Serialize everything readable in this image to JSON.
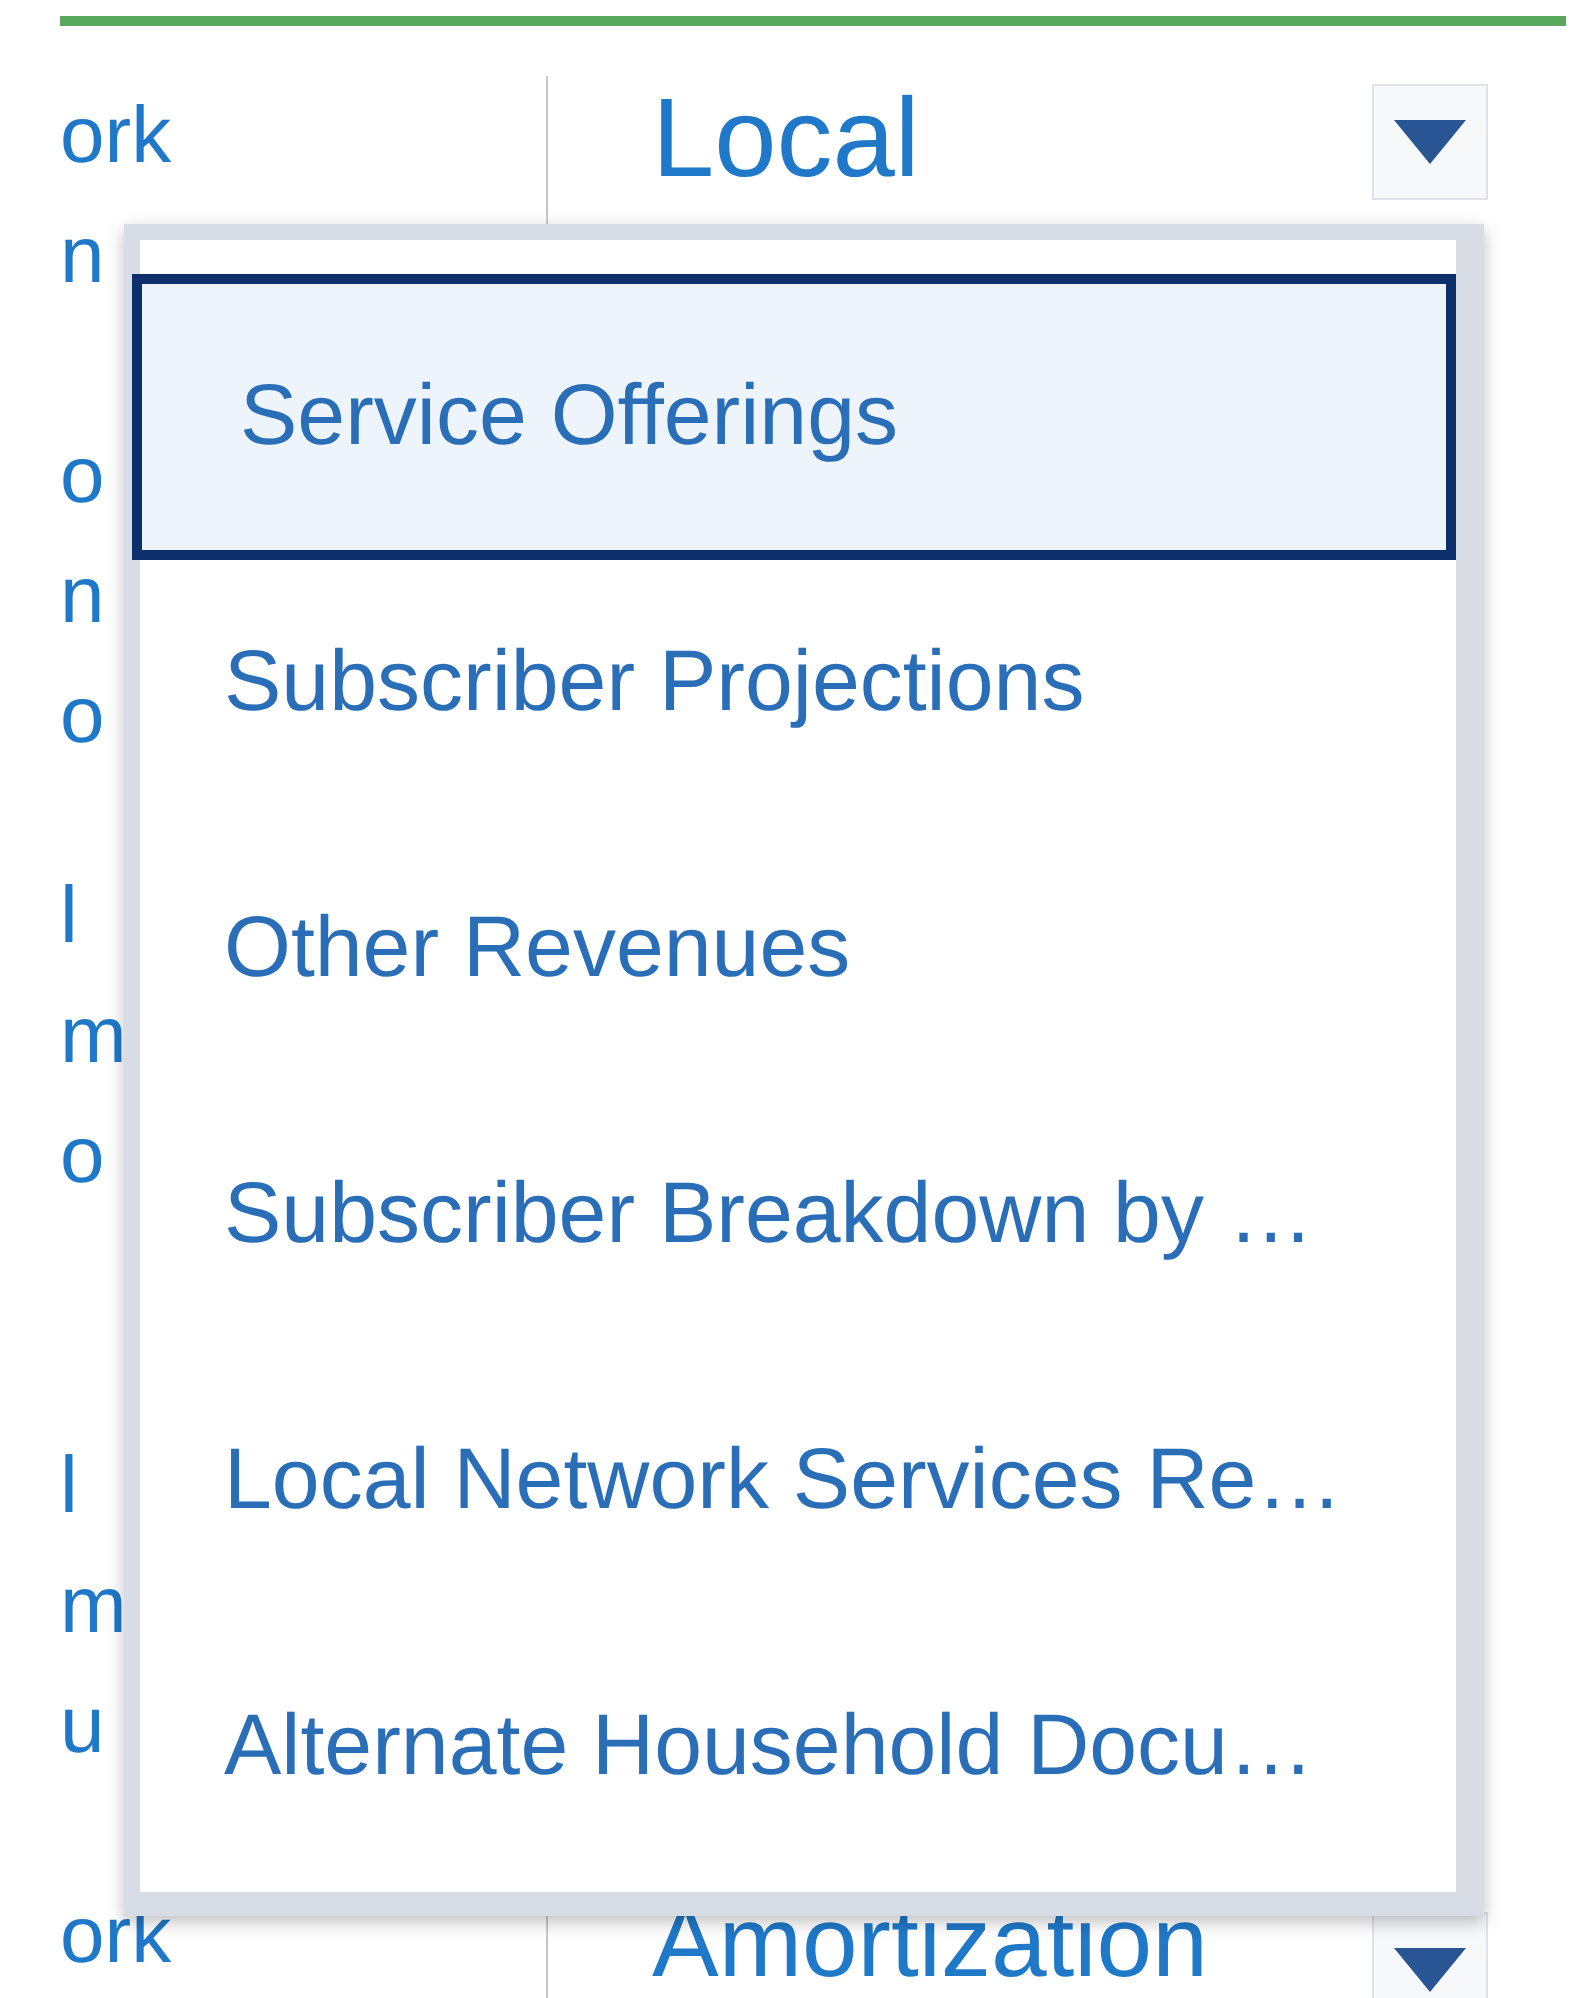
{
  "grid": {
    "rows": [
      {
        "column_1": [
          "ork",
          "n"
        ],
        "column_2": {
          "text": "Local",
          "dropdown": true
        }
      },
      {
        "column_1": [
          "o",
          "n",
          "o"
        ]
      },
      {
        "column_1": [
          "l",
          "m",
          "o"
        ]
      },
      {
        "column_1": [
          "l",
          "m",
          "u"
        ]
      },
      {
        "column_1": [
          "ork"
        ],
        "column_2": {
          "text": "Amortization",
          "dropdown": true
        }
      }
    ]
  },
  "dropdown": {
    "items": [
      {
        "label": "Service Offerings",
        "selected": true
      },
      {
        "label": "Subscriber Projections",
        "selected": false
      },
      {
        "label": "Other Revenues",
        "selected": false
      },
      {
        "label": "Subscriber Breakdown by …",
        "selected": false
      },
      {
        "label": "Local Network Services Re…",
        "selected": false
      },
      {
        "label": "Alternate Household Docu…",
        "selected": false
      }
    ]
  }
}
